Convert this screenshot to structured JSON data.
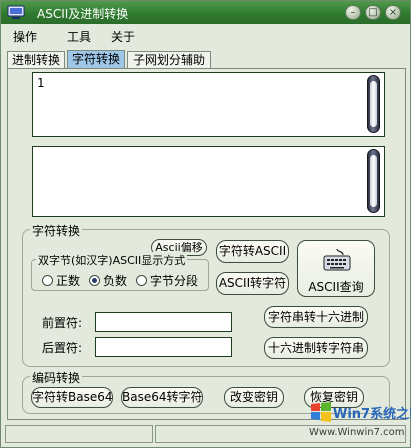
{
  "window": {
    "title": "ASCII及进制转换"
  },
  "titlebar": {
    "minimize_icon": "minimize-icon",
    "restore_icon": "restore-icon",
    "close_icon": "close-icon"
  },
  "menu": {
    "items": [
      "操作",
      "工具",
      "关于"
    ]
  },
  "tabs": [
    {
      "label": "进制转换"
    },
    {
      "label": "字符转换",
      "active": true
    },
    {
      "label": "子网划分辅助"
    }
  ],
  "input_text": "1",
  "output_text": "",
  "char_group": {
    "title": "字符转换",
    "ascii_shift_button": "Ascii偏移",
    "dbcs_frame_title": "双字节(如汉字)ASCII显示方式",
    "radio_options": [
      "正数",
      "负数",
      "字节分段"
    ],
    "radio_selected": "负数",
    "char_to_ascii_button": "字符转ASCII",
    "ascii_query_button": "ASCII查询",
    "ascii_to_char_button": "ASCII转字符",
    "prefix_label": "前置符:",
    "suffix_label": "后置符:",
    "prefix_value": "",
    "suffix_value": "",
    "str_to_hex_button": "字符串转十六进制",
    "hex_to_str_button": "十六进制转字符串"
  },
  "encode_group": {
    "title": "编码转换",
    "to_base64_button": "字符转Base64",
    "from_base64_button": "Base64转字符",
    "change_key_button": "改变密钥",
    "restore_key_button": "恢复密钥"
  },
  "watermark": {
    "brand": "Win7系统之家",
    "url": "Www.Winwin7.com"
  },
  "colors": {
    "titlebar": "#2f7a2f",
    "active_tab": "#9ec6e6",
    "background": "#e3eadd"
  }
}
